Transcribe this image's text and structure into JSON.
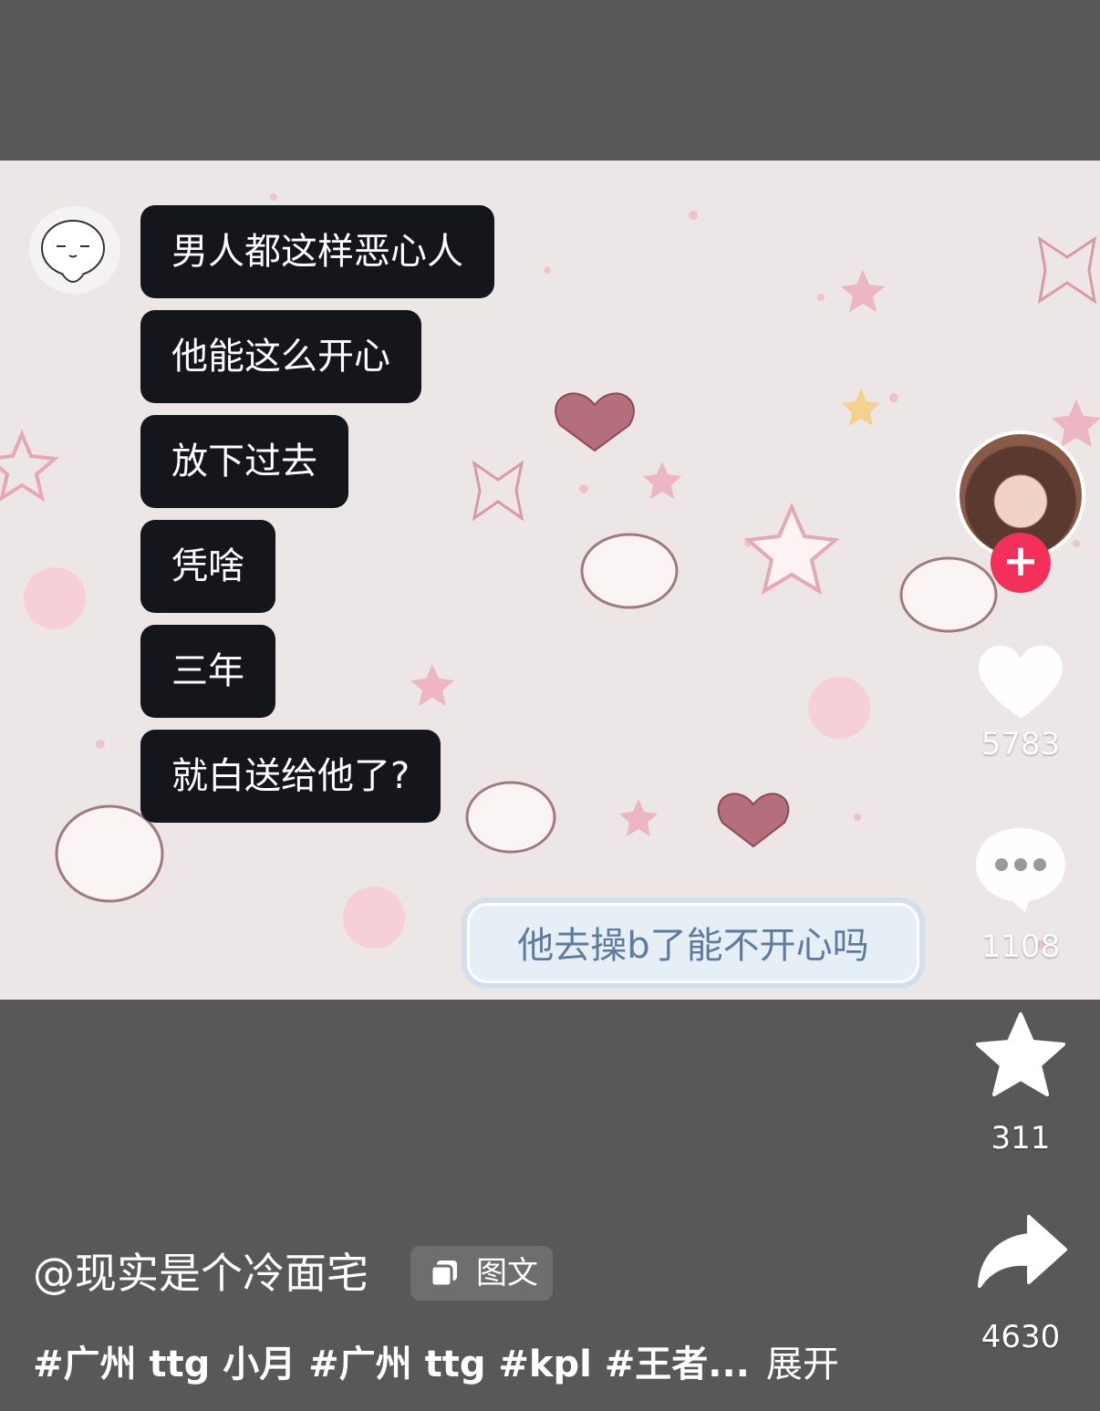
{
  "chat": {
    "messages": [
      {
        "text": "男人都这样恶心人"
      },
      {
        "text": "他能这么开心"
      },
      {
        "text": "放下过去"
      },
      {
        "text": "凭啥"
      },
      {
        "text": "三年"
      },
      {
        "text": "就白送给他了?"
      }
    ],
    "reply": "他去操b了能不开心吗"
  },
  "sidebar": {
    "follow_symbol": "+",
    "likes": "5783",
    "comments": "1108",
    "favorites": "311",
    "shares": "4630"
  },
  "post": {
    "author": "@现实是个冷面宅",
    "type_tag": "图文",
    "hashtags": "#广州 ttg 小月 #广州 ttg #kpl #王者...",
    "expand": "展开"
  },
  "icons": {
    "like": "heart-icon",
    "comment": "comment-bubble-icon",
    "favorite": "star-icon",
    "share": "share-arrow-icon",
    "type": "image-post-icon"
  },
  "colors": {
    "background": "#585858",
    "chat_bubble": "#14161c",
    "follow_button": "#f2305a",
    "reply_text": "#5f7ca0"
  }
}
